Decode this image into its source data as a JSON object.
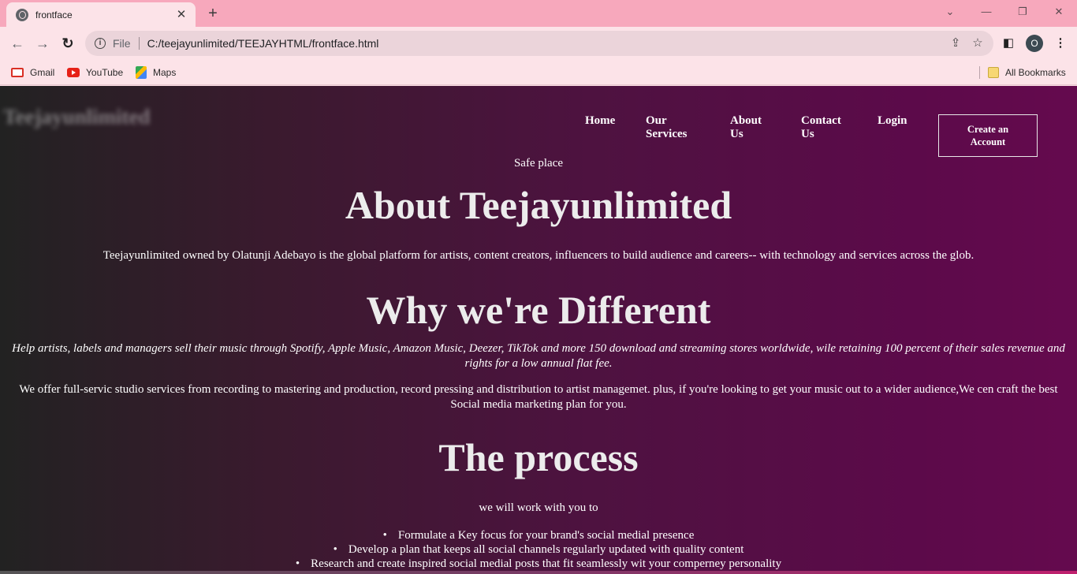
{
  "browser": {
    "tab_title": "frontface",
    "close_glyph": "✕",
    "new_tab_glyph": "+",
    "omnibox_scheme": "File",
    "url": "C:/teejayunlimited/TEEJAYHTML/frontface.html",
    "profile_initial": "O",
    "bookmarks": [
      {
        "label": "Gmail",
        "icon": "gmail-icon"
      },
      {
        "label": "YouTube",
        "icon": "youtube-icon"
      },
      {
        "label": "Maps",
        "icon": "maps-icon"
      }
    ],
    "all_bookmarks": "All Bookmarks"
  },
  "page": {
    "brand": "Teejayunlimited",
    "nav": [
      {
        "label": "Home"
      },
      {
        "label": "Our Services"
      },
      {
        "label": "About Us"
      },
      {
        "label": "Contact Us"
      },
      {
        "label": "Login"
      }
    ],
    "cta": "Create an Account",
    "tagline": "Safe place",
    "about_heading": "About Teejayunlimited",
    "about_text": "Teejayunlimited owned by Olatunji Adebayo is the global platform for artists, content creators, influencers to build audience and careers-- with technology and services across the glob.",
    "diff_heading": "Why we're Different",
    "help_text": "Help artists, labels and managers sell their music through Spotify, Apple Music, Amazon Music, Deezer, TikTok and more 150 download and streaming stores worldwide, wile retaining 100 percent of their sales revenue and rights for a low annual flat fee.",
    "offer_text": "We offer full-servic studio services from recording to mastering and production, record pressing and distribution to artist managemet. plus, if you're looking to get your music out to a wider audience,We cen craft the best Social media marketing plan for you.",
    "process_heading": "The process",
    "work_text": "we will work with you to",
    "steps": [
      "Formulate a Key focus for your brand's social medial presence",
      "Develop a plan that keeps all social channels regularly updated with quality content",
      "Research and create inspired social medial posts that fit seamlessly wit your comperney personality"
    ],
    "colors": {
      "tab_strip": "#f7a8bc",
      "toolbar": "#fce3e8",
      "gradient_start": "#222222",
      "gradient_end": "#650a4e"
    }
  }
}
